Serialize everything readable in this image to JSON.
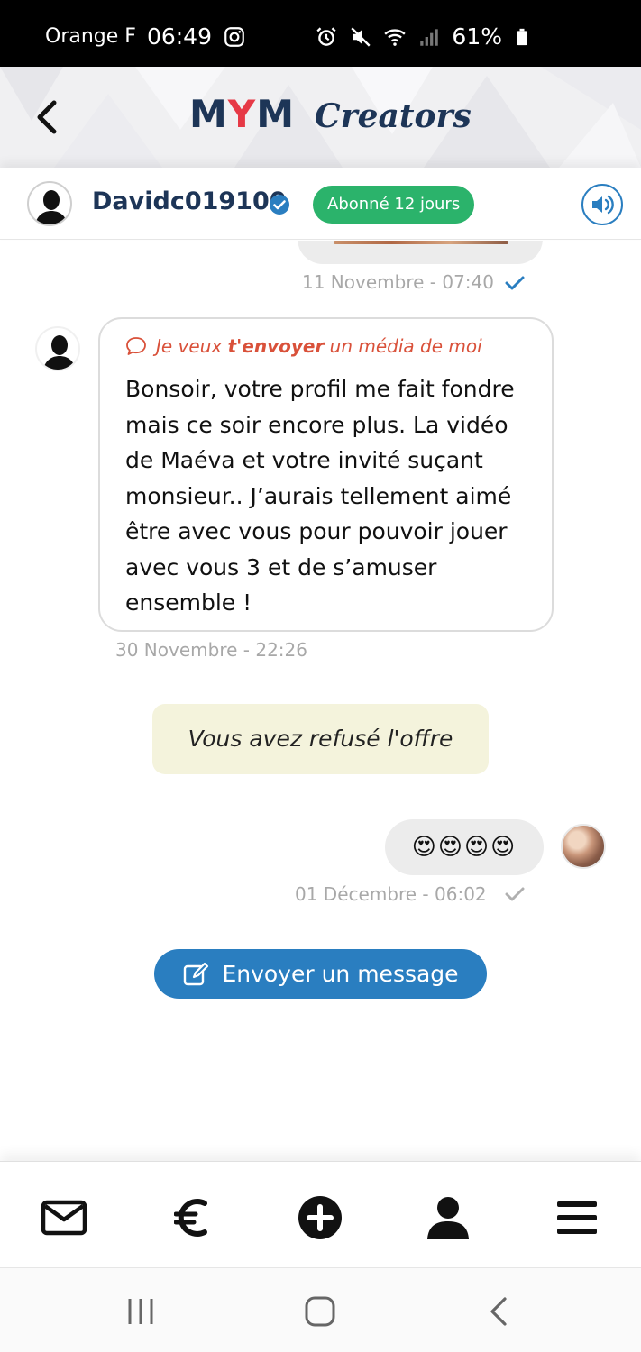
{
  "status_bar": {
    "carrier": "Orange F",
    "time": "06:49",
    "battery": "61%",
    "left_icons": [
      "instagram-icon"
    ],
    "right_icons": [
      "alarm-icon",
      "mute-icon",
      "wifi-icon",
      "signal-icon",
      "battery-icon"
    ]
  },
  "header": {
    "brand": "MYM",
    "brand_parts": [
      "M",
      "Y",
      "M"
    ],
    "subtitle": "Creators",
    "brand_colors": {
      "navy": "#1d3557",
      "red": "#e63946"
    }
  },
  "conversation": {
    "username": "Davidc019100",
    "verified": true,
    "subscription_badge": "Abonné 12 jours",
    "badge_color": "#2bb36b",
    "accent_color": "#2a7ec0"
  },
  "messages": {
    "previous_timestamp": "11 Novembre - 07:40",
    "incoming": {
      "offer_prefix": "Je veux ",
      "offer_bold": "t'envoyer",
      "offer_suffix": " un média de moi",
      "text": "Bonsoir, votre profil me fait fondre mais ce soir encore plus. La vidéo de Maéva et votre invité suçant monsieur.. J’aurais tellement aimé être avec vous pour pouvoir jouer avec vous 3 et de s’amuser ensemble !",
      "timestamp": "30 Novembre - 22:26"
    },
    "system_notice": "Vous avez refusé l'offre",
    "outgoing": {
      "text": "😍😍😍😍",
      "timestamp": "01 Décembre - 06:02"
    }
  },
  "actions": {
    "send_message": "Envoyer un message"
  },
  "bottom_nav": {
    "items": [
      "messages-icon",
      "euro-icon",
      "add-icon",
      "profile-icon",
      "menu-icon"
    ]
  },
  "system_nav": {
    "items": [
      "recents-icon",
      "home-icon",
      "back-icon"
    ]
  }
}
